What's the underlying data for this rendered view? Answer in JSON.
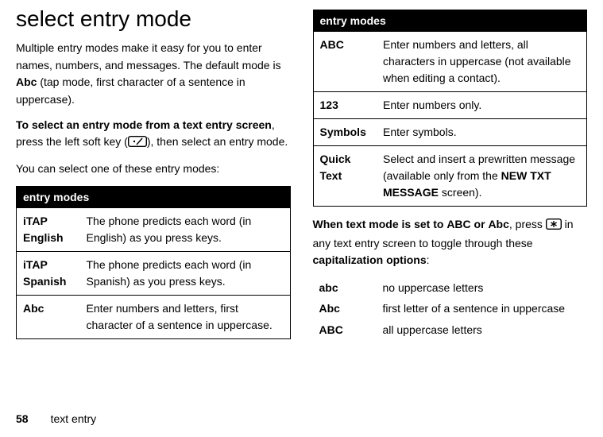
{
  "heading": "select entry mode",
  "intro": {
    "p1_a": "Multiple entry modes make it easy for you to enter names, numbers, and messages. The default mode is ",
    "p1_mode": "Abc",
    "p1_b": " (tap mode, first character of a sentence in uppercase).",
    "p2_a": "To select an entry mode from a text entry screen",
    "p2_b": ", press the left soft key (",
    "p2_c": "), then select an entry mode.",
    "p3": "You can select one of these entry modes:"
  },
  "table_header": "entry modes",
  "modes_left": [
    {
      "mode": "iTAP English",
      "desc": "The phone predicts each word (in English) as you press keys."
    },
    {
      "mode": "iTAP Spanish",
      "desc": "The phone predicts each word (in Spanish) as you press keys."
    },
    {
      "mode": "Abc",
      "desc": "Enter numbers and letters, first character of a sentence in uppercase."
    }
  ],
  "modes_right": [
    {
      "mode": "ABC",
      "desc": "Enter numbers and letters, all characters in uppercase (not available when editing a contact)."
    },
    {
      "mode": "123",
      "desc": "Enter numbers only."
    },
    {
      "mode": "Symbols",
      "desc": "Enter symbols."
    },
    {
      "mode": "Quick Text",
      "desc_a": "Select and insert a prewritten message (available only from the ",
      "desc_mode": "NEW TXT MESSAGE",
      "desc_b": " screen)."
    }
  ],
  "toggle": {
    "a": "When text mode is set to ",
    "mode1": "ABC",
    "b": " or ",
    "mode2": "Abc",
    "c": ", press ",
    "d": " in any text entry screen to toggle through these ",
    "e": "capitalization options",
    "f": ":"
  },
  "caps": [
    {
      "mode": "abc",
      "desc": "no uppercase letters"
    },
    {
      "mode": "Abc",
      "desc": "first letter of a sentence in uppercase"
    },
    {
      "mode": "ABC",
      "desc": "all uppercase letters"
    }
  ],
  "footer": {
    "page": "58",
    "section": "text entry"
  }
}
